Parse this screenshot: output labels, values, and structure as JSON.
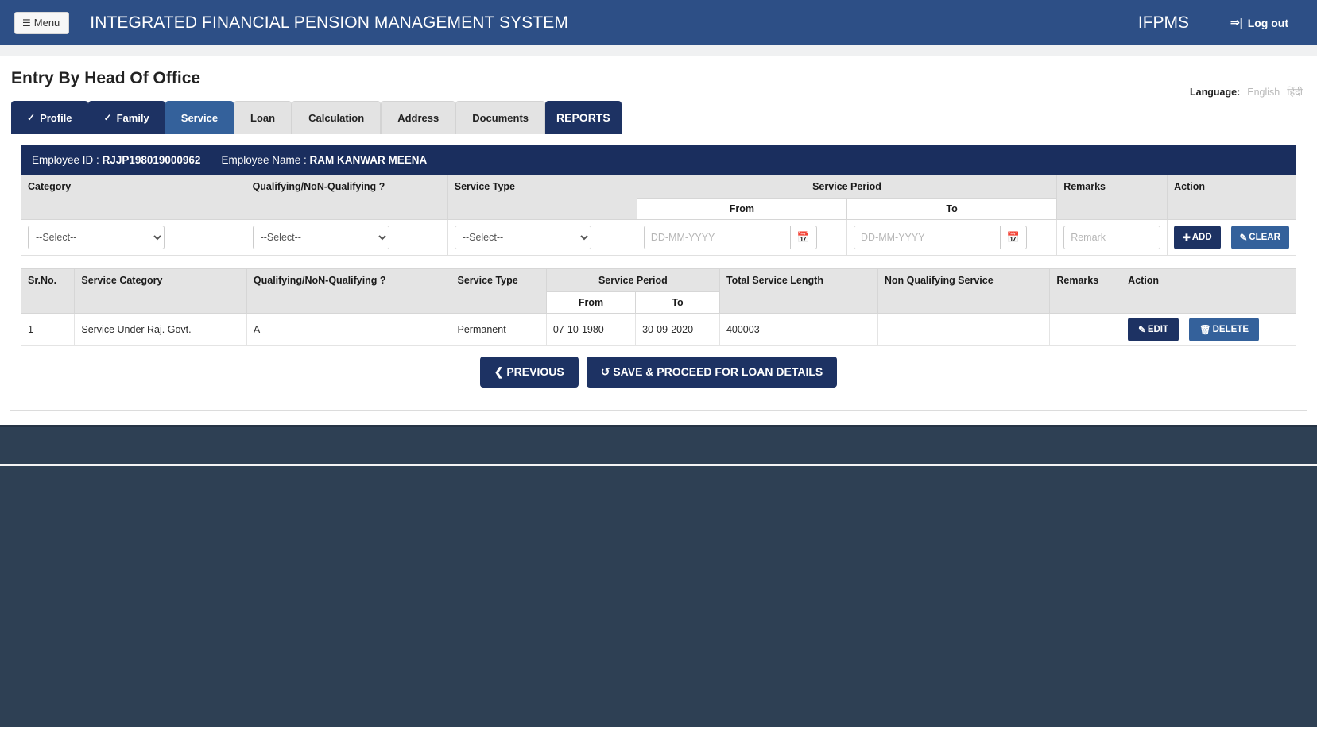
{
  "navbar": {
    "menu_label": "Menu",
    "menu_icon": "hamburger-icon",
    "brand": "INTEGRATED FINANCIAL PENSION MANAGEMENT SYSTEM",
    "ifpms": "IFPMS",
    "logout_label": "Log out",
    "logout_icon": "logout-icon",
    "bg_color": "#2d4f86"
  },
  "page": {
    "title": "Entry By Head Of Office"
  },
  "language": {
    "label": "Language:",
    "options": [
      "English",
      "हिंदी"
    ],
    "selected": "English"
  },
  "tabs": [
    {
      "label": "Profile",
      "state": "completed",
      "icon": "check-circle-icon"
    },
    {
      "label": "Family",
      "state": "completed",
      "icon": "check-circle-icon"
    },
    {
      "label": "Service",
      "state": "active",
      "icon": ""
    },
    {
      "label": "Loan",
      "state": "inactive",
      "icon": ""
    },
    {
      "label": "Calculation",
      "state": "inactive",
      "icon": ""
    },
    {
      "label": "Address",
      "state": "inactive",
      "icon": ""
    },
    {
      "label": "Documents",
      "state": "inactive",
      "icon": ""
    },
    {
      "label": "REPORTS",
      "state": "reports",
      "icon": ""
    }
  ],
  "employee": {
    "id_label": "Employee ID :",
    "id_value": "RJJP198019000962",
    "name_label": "Employee Name :",
    "name_value": "RAM KANWAR MEENA"
  },
  "entry_form": {
    "headers": {
      "category": "Category",
      "qualifying": "Qualifying/NoN-Qualifying ?",
      "service_type": "Service Type",
      "service_period": "Service Period",
      "from": "From",
      "to": "To",
      "remarks": "Remarks",
      "action": "Action"
    },
    "fields": {
      "category_value": "--Select--",
      "qualifying_value": "--Select--",
      "service_type_value": "--Select--",
      "from_value": "",
      "from_placeholder": "DD-MM-YYYY",
      "to_value": "",
      "to_placeholder": "DD-MM-YYYY",
      "remark_value": "",
      "remark_placeholder": "Remark",
      "calendar_icon": "calendar-icon"
    },
    "buttons": {
      "add": "ADD",
      "add_icon": "plus-circle-icon",
      "clear": "CLEAR",
      "clear_icon": "eraser-icon"
    }
  },
  "service_table": {
    "headers": {
      "sr_no": "Sr.No.",
      "service_category": "Service Category",
      "qualifying": "Qualifying/NoN-Qualifying ?",
      "service_type": "Service Type",
      "service_period": "Service Period",
      "from": "From",
      "to": "To",
      "total_service_length": "Total Service Length",
      "non_qualifying_service": "Non Qualifying Service",
      "remarks": "Remarks",
      "action": "Action"
    },
    "rows": [
      {
        "sr_no": "1",
        "service_category": "Service Under Raj. Govt.",
        "qualifying": "A",
        "service_type": "Permanent",
        "from": "07-10-1980",
        "to": "30-09-2020",
        "total_service_length": "400003",
        "non_qualifying_service": "",
        "remarks": "",
        "edit_label": "EDIT",
        "edit_icon": "pencil-icon",
        "delete_label": "DELETE",
        "delete_icon": "trash-icon"
      }
    ]
  },
  "footer_buttons": {
    "previous": "PREVIOUS",
    "previous_icon": "chevron-left-icon",
    "save_proceed": "SAVE & PROCEED FOR LOAN DETAILS",
    "save_icon": "refresh-icon"
  },
  "colors": {
    "navbar": "#2d4f86",
    "navy": "#1d3263",
    "blue": "#34619b",
    "emp_bar": "#1a2e5e",
    "footer": "#2e4054"
  }
}
